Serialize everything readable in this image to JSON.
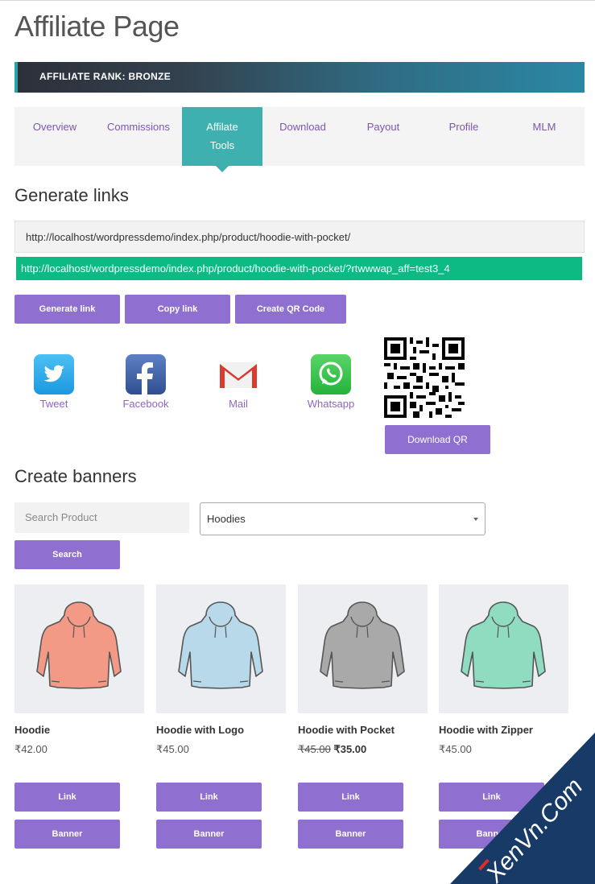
{
  "page_title": "Affiliate Page",
  "rank": "AFFILIATE RANK: BRONZE",
  "tabs": [
    {
      "label": "Overview"
    },
    {
      "label": "Commissions"
    },
    {
      "label": "Affilate Tools"
    },
    {
      "label": "Download"
    },
    {
      "label": "Payout"
    },
    {
      "label": "Profile"
    },
    {
      "label": "MLM"
    }
  ],
  "generate": {
    "heading": "Generate links",
    "input_value": "http://localhost/wordpressdemo/index.php/product/hoodie-with-pocket/",
    "generated_link": "http://localhost/wordpressdemo/index.php/product/hoodie-with-pocket/?rtwwwap_aff=test3_4",
    "generate_btn": "Generate link",
    "copy_btn": "Copy link",
    "qr_btn": "Create QR Code"
  },
  "social": {
    "tweet": "Tweet",
    "facebook": "Facebook",
    "mail": "Mail",
    "whatsapp": "Whatsapp",
    "download_qr": "Download QR"
  },
  "banners": {
    "heading": "Create banners",
    "search_placeholder": "Search Product",
    "category_selected": "Hoodies",
    "search_btn": "Search",
    "link_label": "Link",
    "banner_label": "Banner"
  },
  "products": [
    {
      "name": "Hoodie",
      "price": "₹42.00",
      "old_price": "",
      "color": "#f29a86"
    },
    {
      "name": "Hoodie with Logo",
      "price": "₹45.00",
      "old_price": "",
      "color": "#b8d9ea"
    },
    {
      "name": "Hoodie with Pocket",
      "price": "₹35.00",
      "old_price": "₹45.00",
      "color": "#a9a9a9"
    },
    {
      "name": "Hoodie with Zipper",
      "price": "₹45.00",
      "old_price": "",
      "color": "#8fdcc0"
    }
  ],
  "watermark_text": "XenVn.Com"
}
